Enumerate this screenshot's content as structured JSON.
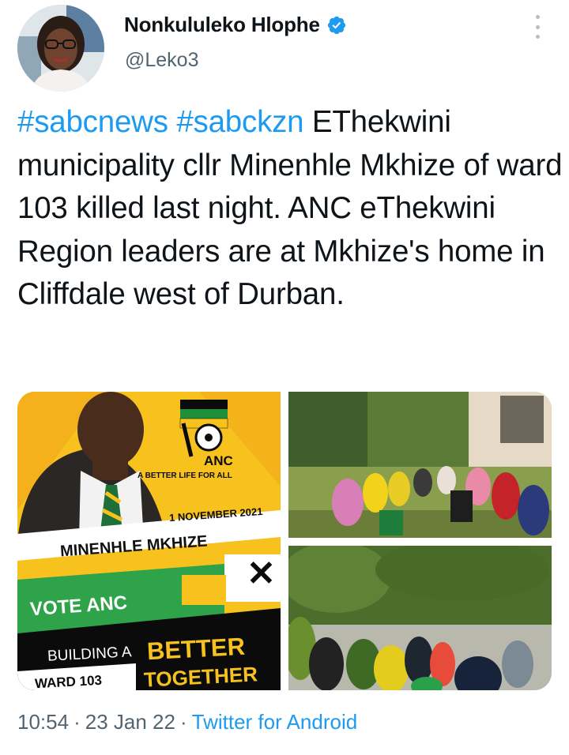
{
  "author": {
    "name": "Nonkululeko Hlophe",
    "handle": "@Leko3",
    "verified": true
  },
  "tweet": {
    "hashtag1": "#sabcnews",
    "hashtag2": "#sabckzn",
    "text": "EThekwini municipality cllr Minenhle Mkhize of ward 103 killed last night. ANC eThekwini Region leaders are at Mkhize's home in Cliffdale west of Durban."
  },
  "poster": {
    "brand": "ANC",
    "tagline": "A BETTER LIFE FOR ALL",
    "date": "1 NOVEMBER 2021",
    "candidate": "MINENHLE MKHIZE",
    "vote": "VOTE ANC",
    "building": "BUILDING A",
    "better": "BETTER",
    "ward": "WARD 103",
    "together": "TOGETHER",
    "mark": "✕"
  },
  "meta": {
    "time": "10:54",
    "date": "23 Jan 22",
    "source": "Twitter for Android"
  },
  "colors": {
    "link": "#1d9bf0",
    "secondary": "#536471",
    "verified": "#1d9bf0",
    "anc_yellow": "#f7c21d",
    "anc_green": "#1f8f3a"
  },
  "icons": {
    "verified": "verified-badge-icon",
    "more": "more-options-icon"
  }
}
